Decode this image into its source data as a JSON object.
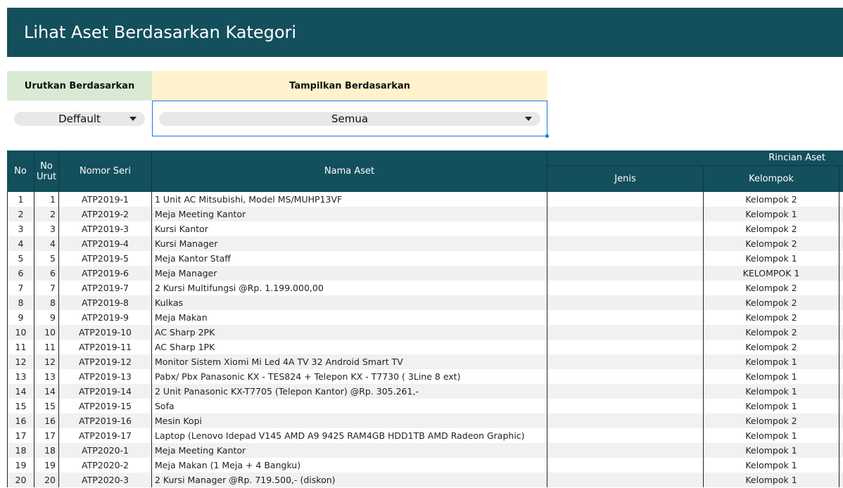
{
  "page": {
    "title": "Lihat Aset Berdasarkan Kategori"
  },
  "filters": {
    "sort_label": "Urutkan Berdasarkan",
    "show_label": "Tampilkan Berdasarkan",
    "sort_value": "Deffault",
    "show_value": "Semua"
  },
  "table": {
    "headers": {
      "no": "No",
      "no_urut": "No Urut",
      "nomor_seri": "Nomor Seri",
      "nama_aset": "Nama Aset",
      "rincian_aset": "Rincian Aset",
      "jenis": "Jenis",
      "kelompok": "Kelompok"
    },
    "rows": [
      {
        "no": "1",
        "urut": "1",
        "seri": "ATP2019-1",
        "nama": "1 Unit AC Mitsubishi, Model MS/MUHP13VF",
        "jenis": "",
        "kelompok": "Kelompok 2"
      },
      {
        "no": "2",
        "urut": "2",
        "seri": "ATP2019-2",
        "nama": "Meja Meeting Kantor",
        "jenis": "",
        "kelompok": "Kelompok 1"
      },
      {
        "no": "3",
        "urut": "3",
        "seri": "ATP2019-3",
        "nama": "Kursi Kantor",
        "jenis": "",
        "kelompok": "Kelompok 2"
      },
      {
        "no": "4",
        "urut": "4",
        "seri": "ATP2019-4",
        "nama": "Kursi Manager",
        "jenis": "",
        "kelompok": "Kelompok 2"
      },
      {
        "no": "5",
        "urut": "5",
        "seri": "ATP2019-5",
        "nama": "Meja Kantor Staff",
        "jenis": "",
        "kelompok": "Kelompok 1"
      },
      {
        "no": "6",
        "urut": "6",
        "seri": "ATP2019-6",
        "nama": "Meja Manager",
        "jenis": "",
        "kelompok": "KELOMPOK 1"
      },
      {
        "no": "7",
        "urut": "7",
        "seri": "ATP2019-7",
        "nama": "2 Kursi Multifungsi @Rp. 1.199.000,00",
        "jenis": "",
        "kelompok": "Kelompok 2"
      },
      {
        "no": "8",
        "urut": "8",
        "seri": "ATP2019-8",
        "nama": "Kulkas",
        "jenis": "",
        "kelompok": "Kelompok 2"
      },
      {
        "no": "9",
        "urut": "9",
        "seri": "ATP2019-9",
        "nama": "Meja Makan",
        "jenis": "",
        "kelompok": "Kelompok 2"
      },
      {
        "no": "10",
        "urut": "10",
        "seri": "ATP2019-10",
        "nama": "AC Sharp 2PK",
        "jenis": "",
        "kelompok": "Kelompok 2"
      },
      {
        "no": "11",
        "urut": "11",
        "seri": "ATP2019-11",
        "nama": "AC Sharp 1PK",
        "jenis": "",
        "kelompok": "Kelompok 2"
      },
      {
        "no": "12",
        "urut": "12",
        "seri": "ATP2019-12",
        "nama": "Monitor Sistem Xiomi Mi Led 4A TV 32 Android Smart TV",
        "jenis": "",
        "kelompok": "Kelompok 1"
      },
      {
        "no": "13",
        "urut": "13",
        "seri": "ATP2019-13",
        "nama": "Pabx/ Pbx Panasonic KX - TES824 + Telepon KX - T7730 ( 3Line 8 ext)",
        "jenis": "",
        "kelompok": "Kelompok 1"
      },
      {
        "no": "14",
        "urut": "14",
        "seri": "ATP2019-14",
        "nama": "2 Unit Panasonic KX-T7705 (Telepon Kantor) @Rp. 305.261,-",
        "jenis": "",
        "kelompok": "Kelompok 1"
      },
      {
        "no": "15",
        "urut": "15",
        "seri": "ATP2019-15",
        "nama": "Sofa",
        "jenis": "",
        "kelompok": "Kelompok 1"
      },
      {
        "no": "16",
        "urut": "16",
        "seri": "ATP2019-16",
        "nama": "Mesin Kopi",
        "jenis": "",
        "kelompok": "Kelompok 2"
      },
      {
        "no": "17",
        "urut": "17",
        "seri": "ATP2019-17",
        "nama": "Laptop (Lenovo Idepad V145 AMD A9 9425 RAM4GB HDD1TB AMD Radeon Graphic)",
        "jenis": "",
        "kelompok": "Kelompok 1"
      },
      {
        "no": "18",
        "urut": "18",
        "seri": "ATP2020-1",
        "nama": "Meja Meeting Kantor",
        "jenis": "",
        "kelompok": "Kelompok 1"
      },
      {
        "no": "19",
        "urut": "19",
        "seri": "ATP2020-2",
        "nama": "Meja Makan (1 Meja + 4 Bangku)",
        "jenis": "",
        "kelompok": "Kelompok 1"
      },
      {
        "no": "20",
        "urut": "20",
        "seri": "ATP2020-3",
        "nama": "2 Kursi Manager @Rp. 719.500,- (diskon)",
        "jenis": "",
        "kelompok": "Kelompok 1"
      }
    ]
  }
}
